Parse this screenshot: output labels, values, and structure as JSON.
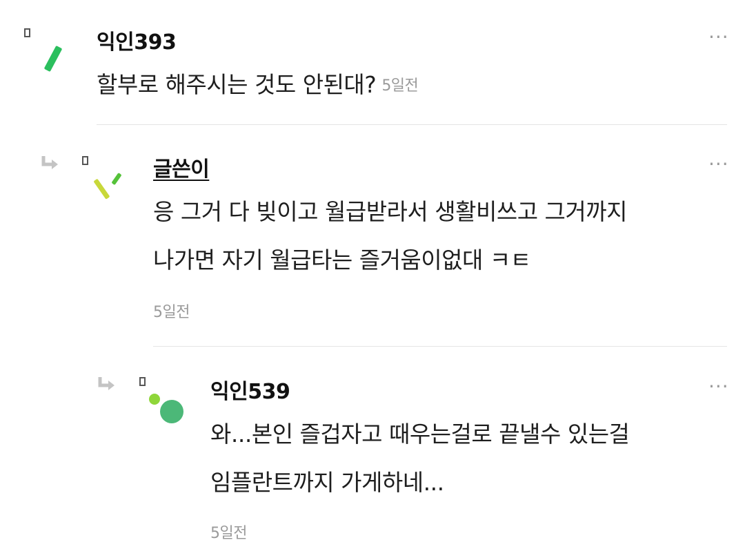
{
  "comments": [
    {
      "author": "익인393",
      "body_lines": [
        "할부로 해주시는 것도 안된대?"
      ],
      "time": "5일전",
      "more_label": "···"
    },
    {
      "author": "글쓴이",
      "body_lines": [
        "응 그거 다 빚이고 월급받라서 생활비쓰고 그거까지",
        "나가면 자기 월급타는 즐거움이없대 ㅋㅌ"
      ],
      "time": "5일전",
      "more_label": "···"
    },
    {
      "author": "익인539",
      "body_lines": [
        "와...본인 즐겁자고 때우는걸로 끝낼수 있는걸",
        "임플란트까지 가게하네..."
      ],
      "time": "5일전",
      "more_label": "···"
    }
  ],
  "colors": {
    "avatar1_green": "#2bbf5e",
    "avatar2_lime": "#c8d83a",
    "avatar2_green": "#55c23a",
    "avatar3_lime": "#8fd63a",
    "avatar3_green": "#4cb878",
    "reply_arrow": "#c4c4c4",
    "divider": "#e4e4e4",
    "time_text": "#9a9a9a"
  },
  "icons": {
    "reply": "reply-arrow-icon",
    "more": "more-dots-icon"
  }
}
